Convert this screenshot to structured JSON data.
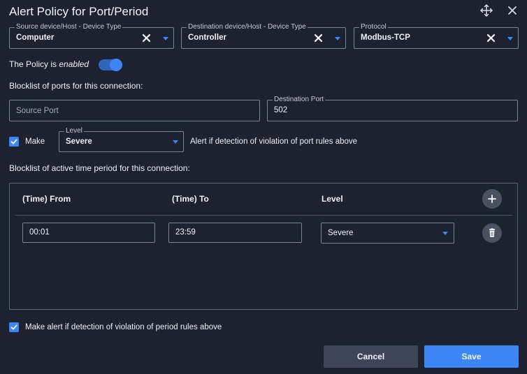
{
  "dialog": {
    "title": "Alert Policy for Port/Period"
  },
  "connection": {
    "source": {
      "legend": "Source device/Host - Device Type",
      "value": "Computer"
    },
    "destination": {
      "legend": "Destination device/Host - Device Type",
      "value": "Controller"
    },
    "protocol": {
      "legend": "Protocol",
      "value": "Modbus-TCP"
    }
  },
  "policy": {
    "prefix": "The Policy is",
    "state": "enabled",
    "enabled": true
  },
  "ports": {
    "section_label": "Blocklist of ports for this connection:",
    "source_port": {
      "placeholder": "Source Port",
      "value": ""
    },
    "destination_port": {
      "legend": "Destination Port",
      "value": "502"
    },
    "make_checkbox": {
      "label": "Make",
      "checked": true
    },
    "level": {
      "legend": "Level",
      "value": "Severe"
    },
    "alert_text": "Alert if detection of violation of port rules above"
  },
  "periods": {
    "section_label": "Blocklist of active time period for this connection:",
    "columns": {
      "from": "(Time) From",
      "to": "(Time) To",
      "level": "Level"
    },
    "rows": [
      {
        "from": "00:01",
        "to": "23:59",
        "level": "Severe"
      }
    ],
    "alert_checkbox": {
      "label": "Make alert if detection of violation of period rules above",
      "checked": true
    }
  },
  "footer": {
    "cancel_label": "Cancel",
    "save_label": "Save"
  },
  "colors": {
    "background": "#1c2230",
    "accent": "#3d86f5",
    "border": "#7a8496",
    "secondary_button": "#3d4557"
  },
  "icons": {
    "move": "move-arrows-icon",
    "close": "close-icon",
    "clear": "clear-x-icon",
    "dropdown": "caret-down-icon",
    "add": "plus-icon",
    "delete": "trash-icon",
    "check": "checkmark-icon"
  }
}
